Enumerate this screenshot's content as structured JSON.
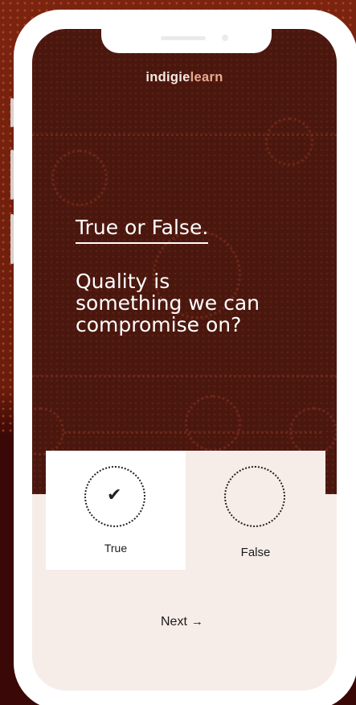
{
  "app": {
    "logo_part1": "indigie",
    "logo_part2": "learn"
  },
  "quiz": {
    "heading": "True or False.",
    "question_lines": [
      "Quality is",
      "something we can",
      "compromise on?"
    ]
  },
  "options": [
    {
      "label": "True",
      "selected": true,
      "icon": "checkmark-icon"
    },
    {
      "label": "False",
      "selected": false,
      "icon": "empty-circle"
    }
  ],
  "navigation": {
    "next_label": "Next",
    "next_icon": "→"
  },
  "colors": {
    "screen_top": "#4a170e",
    "screen_bottom": "#f6ece8",
    "logo_accent": "#e9a98f",
    "text_light": "#ffffff",
    "text_dark": "#1b1b1b"
  }
}
